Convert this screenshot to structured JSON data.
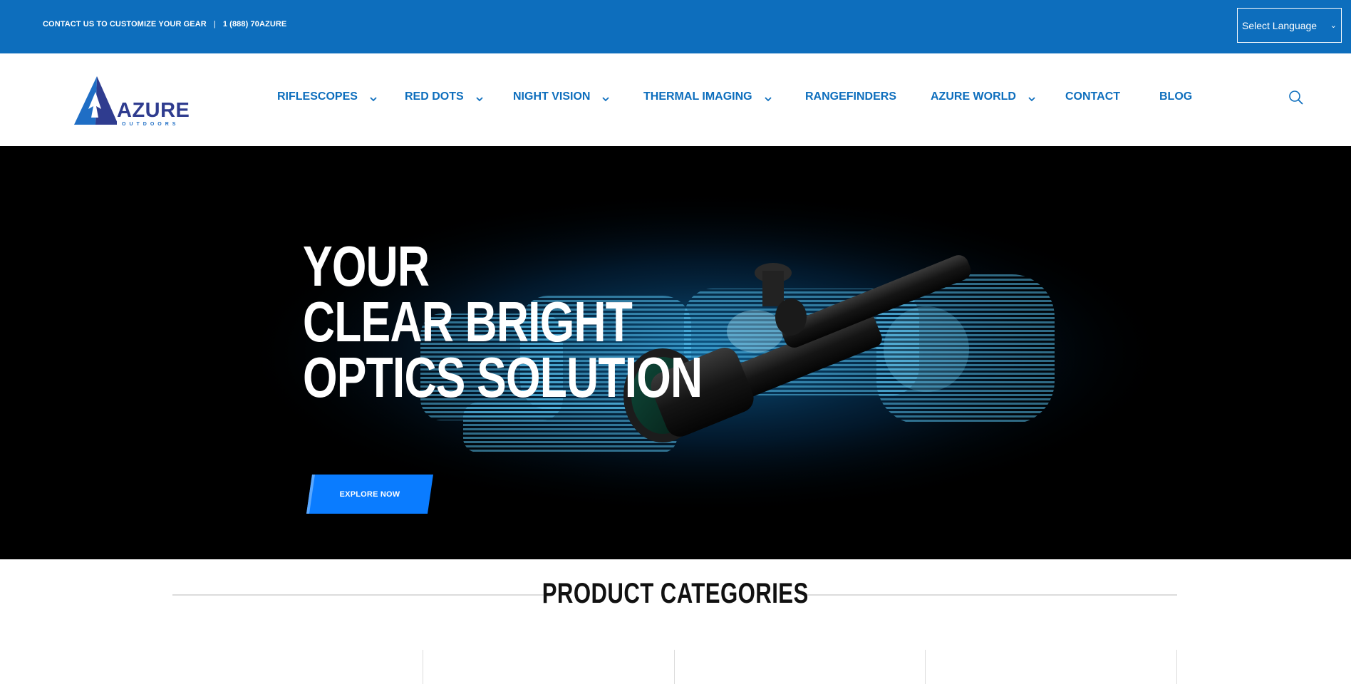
{
  "topbar": {
    "contact_text": "CONTACT US TO CUSTOMIZE YOUR GEAR",
    "separator": "|",
    "phone": "1 (888) 70AZURE",
    "language_select": {
      "selected": "Select Language"
    }
  },
  "header": {
    "logo": {
      "word": "AZURE",
      "sub": "OUTDOORS"
    },
    "nav": [
      {
        "label": "RIFLESCOPES",
        "has_dropdown": true
      },
      {
        "label": "RED DOTS",
        "has_dropdown": true
      },
      {
        "label": "NIGHT VISION",
        "has_dropdown": true
      },
      {
        "label": "THERMAL IMAGING",
        "has_dropdown": true
      },
      {
        "label": "RANGEFINDERS",
        "has_dropdown": false
      },
      {
        "label": "AZURE WORLD",
        "has_dropdown": true
      },
      {
        "label": "CONTACT",
        "has_dropdown": false
      },
      {
        "label": "BLOG",
        "has_dropdown": false
      }
    ],
    "search_icon": "search-icon"
  },
  "hero": {
    "title_lines": [
      "YOUR",
      "CLEAR BRIGHT",
      "OPTICS SOLUTION"
    ],
    "cta_label": "EXPLORE NOW"
  },
  "categories": {
    "title": "PRODUCT CATEGORIES"
  },
  "colors": {
    "brand_blue": "#0d6ebd",
    "cta_blue": "#0a7cff",
    "logo_navy": "#2f3c8f",
    "hero_bg": "#000000",
    "glow": "#1aa7ff"
  }
}
